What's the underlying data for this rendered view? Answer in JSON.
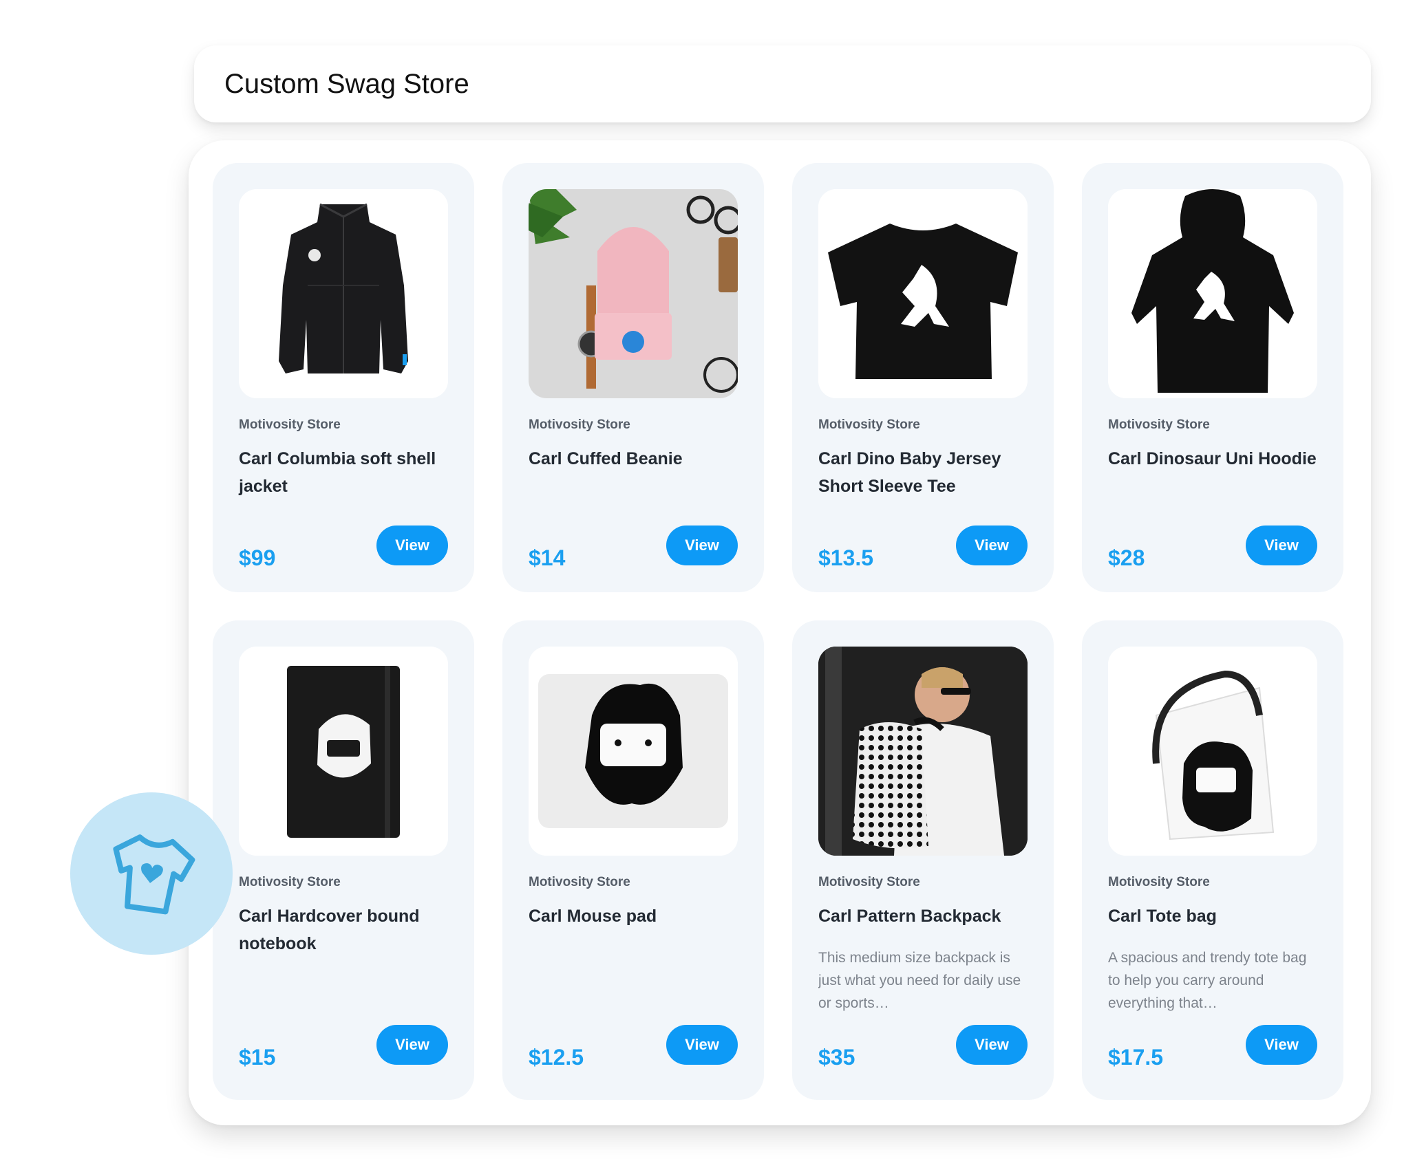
{
  "header": {
    "title": "Custom Swag Store"
  },
  "products": [
    {
      "store": "Motivosity Store",
      "title": "Carl Columbia soft shell jacket",
      "description": "",
      "price": "$99",
      "button": "View"
    },
    {
      "store": "Motivosity Store",
      "title": "Carl Cuffed Beanie",
      "description": "",
      "price": "$14",
      "button": "View"
    },
    {
      "store": "Motivosity Store",
      "title": "Carl Dino Baby Jersey Short Sleeve Tee",
      "description": "",
      "price": "$13.5",
      "button": "View"
    },
    {
      "store": "Motivosity Store",
      "title": "Carl Dinosaur Uni Hoodie",
      "description": "",
      "price": "$28",
      "button": "View"
    },
    {
      "store": "Motivosity Store",
      "title": "Carl Hardcover bound notebook",
      "description": "",
      "price": "$15",
      "button": "View"
    },
    {
      "store": "Motivosity Store",
      "title": "Carl Mouse pad",
      "description": "",
      "price": "$12.5",
      "button": "View"
    },
    {
      "store": "Motivosity Store",
      "title": "Carl Pattern Backpack",
      "description": "This medium size backpack is just what you need for daily use or sports…",
      "price": "$35",
      "button": "View"
    },
    {
      "store": "Motivosity Store",
      "title": "Carl Tote bag",
      "description": "A spacious and trendy tote bag to help you carry around everything that…",
      "price": "$17.5",
      "button": "View"
    }
  ],
  "badge_icon": "tshirt-heart-icon",
  "colors": {
    "accent": "#0d9af6",
    "price": "#1a9ff0",
    "card_bg": "#f2f6fa",
    "badge_bg": "#c5e6f7"
  }
}
